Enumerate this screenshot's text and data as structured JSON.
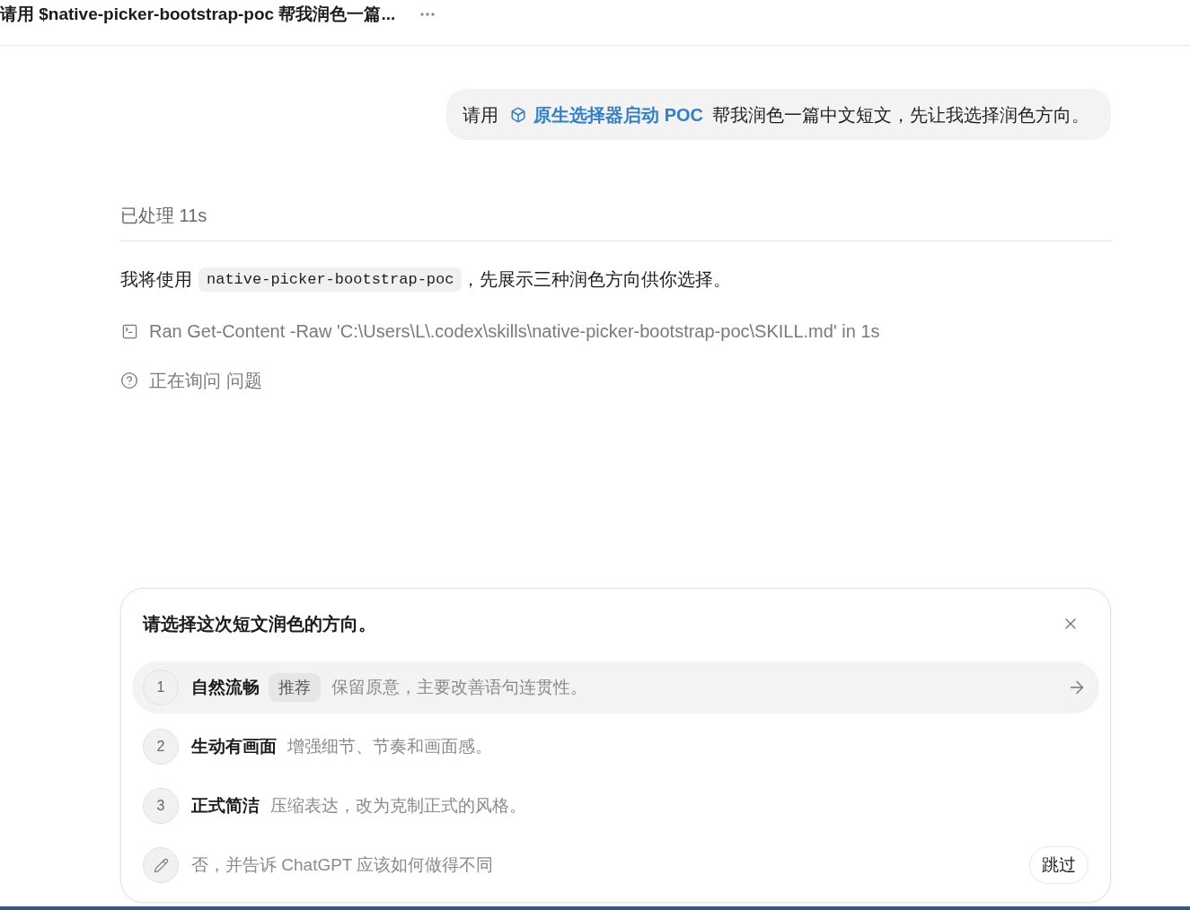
{
  "header": {
    "title": "请用 $native-picker-bootstrap-poc 帮我润色一篇..."
  },
  "user_message": {
    "before": "请用",
    "skill": "原生选择器启动 POC",
    "after": "帮我润色一篇中文短文，先让我选择润色方向。"
  },
  "processed": "已处理 11s",
  "reply": {
    "before": "我将使用",
    "code": "native-picker-bootstrap-poc",
    "after": "，先展示三种润色方向供你选择。"
  },
  "activity": [
    {
      "kind": "command",
      "text": "Ran Get-Content -Raw 'C:\\Users\\L\\.codex\\skills\\native-picker-bootstrap-poc\\SKILL.md' in 1s"
    },
    {
      "kind": "question",
      "text": "正在询问 问题"
    }
  ],
  "picker": {
    "title": "请选择这次短文润色的方向。",
    "options": [
      {
        "number": "1",
        "label": "自然流畅",
        "badge": "推荐",
        "description": "保留原意，主要改善语句连贯性。",
        "selected": true
      },
      {
        "number": "2",
        "label": "生动有画面",
        "description": "增强细节、节奏和画面感。",
        "selected": false
      },
      {
        "number": "3",
        "label": "正式简洁",
        "description": "压缩表达，改为克制正式的风格。",
        "selected": false
      }
    ],
    "other": {
      "placeholder": "否，并告诉 ChatGPT 应该如何做得不同"
    },
    "skip": "跳过"
  }
}
